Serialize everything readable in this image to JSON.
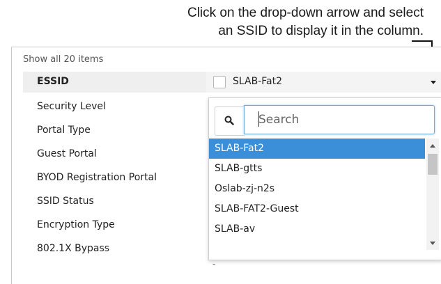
{
  "callout": {
    "line1": "Click on the drop-down arrow and select",
    "line2": "an SSID to display it in the column."
  },
  "table": {
    "show_all": "Show all 20 items",
    "essid_label": "ESSID",
    "essid_value": "SLAB-Fat2",
    "rows": [
      "Security Level",
      "Portal Type",
      "Guest Portal",
      "BYOD Registration Portal",
      "SSID Status",
      "Encryption Type",
      "802.1X Bypass"
    ],
    "bypass_value": "-"
  },
  "dropdown": {
    "search_placeholder": "Search",
    "options": [
      "SLAB-Fat2",
      "SLAB-gtts",
      "Oslab-zj-n2s",
      "SLAB-FAT2-Guest",
      "SLAB-av"
    ],
    "selected_index": 0
  },
  "colors": {
    "selected_bg": "#3b8fd9",
    "focus_border": "#6fa8dc"
  }
}
